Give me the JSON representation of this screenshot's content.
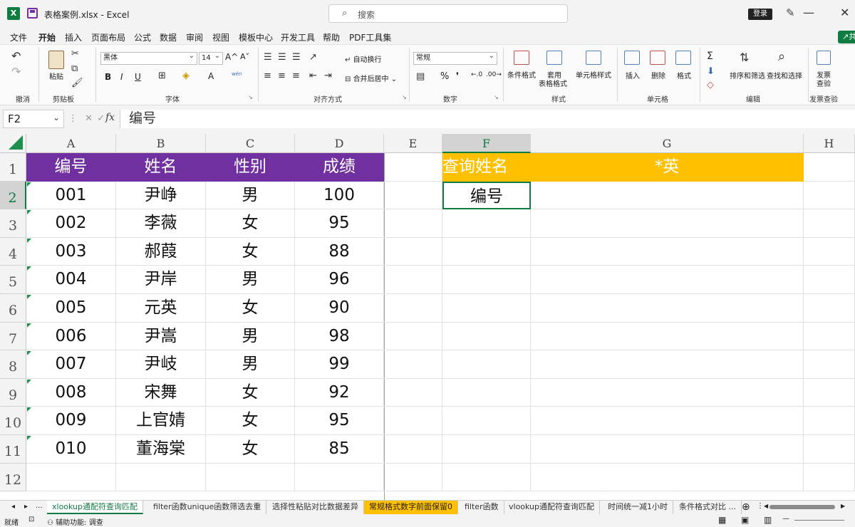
{
  "titlebar": {
    "app_badge": "X",
    "doc_title": "表格案例.xlsx",
    "app_name": "Excel",
    "title_sep": "-",
    "search_placeholder": "搜索",
    "login_label": "登录"
  },
  "menu": [
    "文件",
    "开始",
    "插入",
    "页面布局",
    "公式",
    "数据",
    "审阅",
    "视图",
    "模板中心",
    "开发工具",
    "帮助",
    "PDF工具集"
  ],
  "menu_active": "开始",
  "share_label": "共",
  "ribbon": {
    "undo_group": "撤消",
    "clipboard": {
      "paste": "粘贴",
      "label": "剪贴板"
    },
    "font": {
      "name": "黑体",
      "size": "14",
      "label": "字体",
      "bold": "B",
      "italic": "I",
      "underline": "U",
      "grow": "A^",
      "shrink": "A˅",
      "wen": "wén",
      "font_color": "A"
    },
    "alignment": {
      "wrap": "自动换行",
      "merge": "合并后居中",
      "label": "对齐方式"
    },
    "number": {
      "format": "常规",
      "percent": "%",
      "comma": "❜",
      "label": "数字"
    },
    "styles": {
      "cond": "条件格式",
      "table": "套用",
      "table2": "表格格式",
      "cell": "单元格样式",
      "label": "样式"
    },
    "cells": {
      "insert": "插入",
      "delete": "删除",
      "format": "格式",
      "label": "单元格"
    },
    "editing": {
      "sigma": "Σ",
      "sort": "排序和筛选",
      "find": "查找和选择",
      "label": "编辑"
    },
    "invoice": {
      "line1": "发票",
      "line2": "查验",
      "label": "发票查验"
    }
  },
  "formula_bar": {
    "name_box": "F2",
    "fx": "fx",
    "formula": "编号"
  },
  "columns": [
    "A",
    "B",
    "C",
    "D",
    "E",
    "F",
    "G",
    "H"
  ],
  "selected_column": "F",
  "rows": [
    "1",
    "2",
    "3",
    "4",
    "5",
    "6",
    "7",
    "8",
    "9",
    "10",
    "11",
    "12"
  ],
  "selected_row": "2",
  "table": {
    "headers": [
      "编号",
      "姓名",
      "性别",
      "成绩"
    ],
    "records": [
      [
        "001",
        "尹峥",
        "男",
        "100"
      ],
      [
        "002",
        "李薇",
        "女",
        "95"
      ],
      [
        "003",
        "郝葭",
        "女",
        "88"
      ],
      [
        "004",
        "尹岸",
        "男",
        "96"
      ],
      [
        "005",
        "元英",
        "女",
        "90"
      ],
      [
        "006",
        "尹嵩",
        "男",
        "98"
      ],
      [
        "007",
        "尹岐",
        "男",
        "99"
      ],
      [
        "008",
        "宋舞",
        "女",
        "92"
      ],
      [
        "009",
        "上官婧",
        "女",
        "95"
      ],
      [
        "010",
        "董海棠",
        "女",
        "85"
      ]
    ]
  },
  "query": {
    "label": "查询姓名",
    "value": "*英",
    "result": "编号"
  },
  "colors": {
    "header_purple": "#7030a0",
    "query_yellow": "#ffc000",
    "excel_green": "#107c41"
  },
  "sheet_tabs": [
    "xlookup通配符查询匹配",
    "filter函数unique函数筛选去重",
    "选择性粘贴对比数据差异",
    "常规格式数字前面保留0",
    "filter函数",
    "vlookup通配符查询匹配",
    "时间统一减1小时",
    "条件格式对比 ..."
  ],
  "active_tab": "xlookup通配符查询匹配",
  "highlight_tab": "常规格式数字前面保留0",
  "tab_nav": {
    "prev": "◂",
    "next": "▸",
    "more": "...",
    "add": "⊕"
  },
  "status": {
    "ready": "就绪",
    "accessibility": "辅助功能: 调查"
  }
}
